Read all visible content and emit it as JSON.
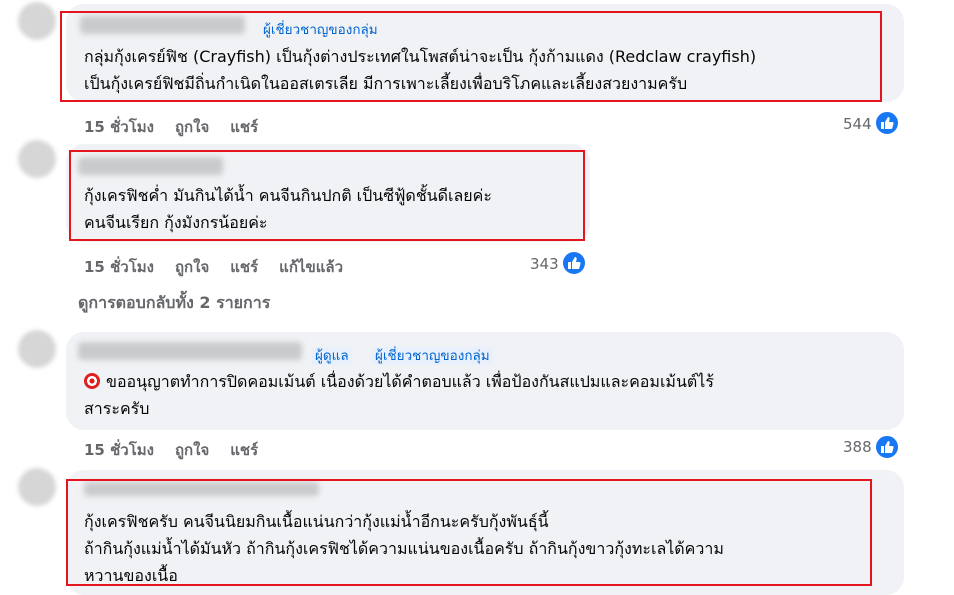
{
  "comments": [
    {
      "badges": [
        "ผู้เชี่ยวชาญของกลุ่ม"
      ],
      "lines": [
        "กลุ่มกุ้งเครย์ฟิช (Crayfish) เป็นกุ้งต่างประเทศในโพสต์น่าจะเป็น กุ้งก้ามแดง (Redclaw crayfish)",
        "เป็นกุ้งเครย์ฟิชมีถิ่นกำเนิดในออสเตรเลีย มีการเพาะเลี้ยงเพื่อบริโภคและเลี้ยงสวยงามครับ"
      ],
      "time": "15 ชั่วโมง",
      "like_label": "ถูกใจ",
      "share_label": "แชร์",
      "reactions": "544"
    },
    {
      "badges": [],
      "lines": [
        "กุ้งเครฟิชค่ำ มันกินได้น้ำ คนจีนกินปกติ เป็นซีฟู้ดชั้นดีเลยค่ะ",
        "คนจีนเรียก กุ้งมังกรน้อยค่ะ"
      ],
      "time": "15 ชั่วโมง",
      "like_label": "ถูกใจ",
      "share_label": "แชร์",
      "edited_label": "แก้ไขแล้ว",
      "reactions": "343"
    },
    {
      "badges": [
        "ผู้ดูแล",
        "ผู้เชี่ยวชาญของกลุ่ม"
      ],
      "lines": [
        "ขออนุญาตทำการปิดคอมเม้นต์ เนื่องด้วยได้คำตอบแล้ว เพื่อป้องกันสแปมและคอมเม้นต์ไร้",
        "สาระครับ"
      ],
      "icon": "target-icon",
      "time": "15 ชั่วโมง",
      "like_label": "ถูกใจ",
      "share_label": "แชร์",
      "reactions": "388"
    },
    {
      "badges": [],
      "lines": [
        "กุ้งเครฟิชครับ คนจีนนิยมกินเนื้อแน่นกว่ากุ้งแม่น้ำอีกนะครับกุ้งพันธุ์นี้",
        "ถ้ากินกุ้งแม่น้ำได้มันหัว ถ้ากินกุ้งเครฟิชได้ความแน่นของเนื้อครับ ถ้ากินกุ้งขาวกุ้งทะเลได้ความ",
        "หวานของเนื้อ"
      ]
    }
  ],
  "view_replies": "ดูการตอบกลับทั้ง 2 รายการ",
  "colors": {
    "highlight": "#e4151d",
    "like": "#1877f2",
    "badge": "#0064d1"
  }
}
